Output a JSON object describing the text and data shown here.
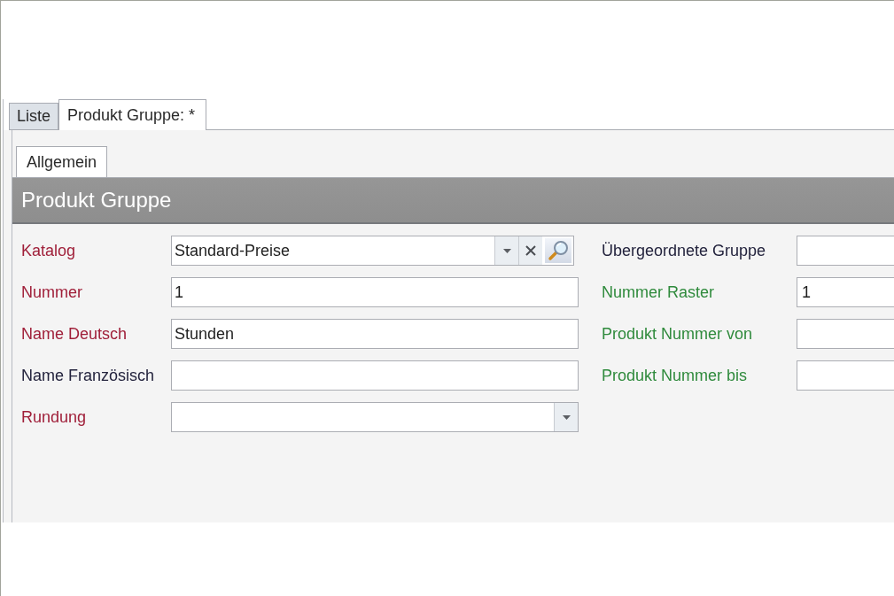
{
  "document_tabs": [
    {
      "label": "Liste",
      "selected": false
    },
    {
      "label": "Produkt Gruppe: *",
      "selected": true
    }
  ],
  "page_tabs": [
    {
      "label": "Allgemein",
      "selected": true
    }
  ],
  "section_header": {
    "title": "Produkt Gruppe"
  },
  "form": {
    "left_fields": [
      {
        "label": "Katalog",
        "color": "#a0203a",
        "kind": "lookup",
        "value": "Standard-Preise"
      },
      {
        "label": "Nummer",
        "color": "#a0203a",
        "kind": "text",
        "value": "1"
      },
      {
        "label": "Name Deutsch",
        "color": "#a0203a",
        "kind": "text",
        "value": "Stunden"
      },
      {
        "label": "Name Französisch",
        "color": "#23233d",
        "kind": "text"
      },
      {
        "label": "Rundung",
        "color": "#a0203a",
        "kind": "dropdown"
      }
    ],
    "right_fields": [
      {
        "label": "Übergeordnete Gruppe",
        "color": "#23233d",
        "kind": "text"
      },
      {
        "label": "Nummer Raster",
        "color": "#2f8a3c",
        "kind": "text",
        "value": "1"
      },
      {
        "label": "Produkt Nummer von",
        "color": "#2f8a3c",
        "kind": "text"
      },
      {
        "label": "Produkt Nummer bis",
        "color": "#2f8a3c",
        "kind": "text"
      }
    ]
  }
}
